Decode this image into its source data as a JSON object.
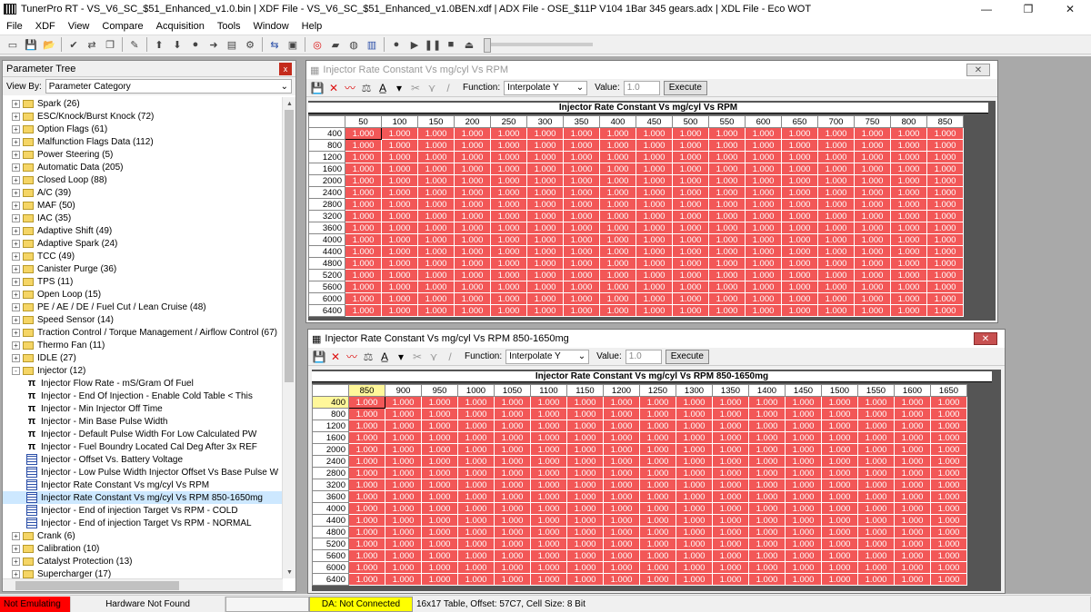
{
  "window": {
    "title": "TunerPro RT - VS_V6_SC_$51_Enhanced_v1.0.bin | XDF File - VS_V6_SC_$51_Enhanced_v1.0BEN.xdf | ADX File - OSE_$11P V104 1Bar 345 gears.adx | XDL File - Eco WOT",
    "minimize": "—",
    "maximize": "❐",
    "close": "✕"
  },
  "menu": [
    "File",
    "XDF",
    "View",
    "Compare",
    "Acquisition",
    "Tools",
    "Window",
    "Help"
  ],
  "toolbar_icons": [
    "new-icon",
    "save-icon",
    "open-icon",
    "check-icon",
    "compare-icon",
    "copy-icon",
    "script-icon",
    "up-arrow-icon",
    "down-arrow-icon",
    "record-icon",
    "forward-icon",
    "bookmark-icon",
    "link-icon",
    "swap-icon",
    "chip-icon",
    "target-icon",
    "folder-icon",
    "globe-icon",
    "chart-icon",
    "circle-icon",
    "play-icon",
    "pause-icon",
    "stop-icon",
    "eject-icon"
  ],
  "tree": {
    "title": "Parameter Tree",
    "close": "x",
    "view_by_label": "View By:",
    "view_by_value": "Parameter Category",
    "items": [
      {
        "label": "Spark (26)",
        "type": "folder",
        "exp": "+"
      },
      {
        "label": "ESC/Knock/Burst Knock (72)",
        "type": "folder",
        "exp": "+"
      },
      {
        "label": "Option Flags (61)",
        "type": "folder",
        "exp": "+"
      },
      {
        "label": "Malfunction Flags Data (112)",
        "type": "folder",
        "exp": "+"
      },
      {
        "label": "Power Steering (5)",
        "type": "folder",
        "exp": "+"
      },
      {
        "label": "Automatic Data (205)",
        "type": "folder",
        "exp": "+"
      },
      {
        "label": "Closed Loop (88)",
        "type": "folder",
        "exp": "+"
      },
      {
        "label": "A/C (39)",
        "type": "folder",
        "exp": "+"
      },
      {
        "label": "MAF (50)",
        "type": "folder",
        "exp": "+"
      },
      {
        "label": "IAC (35)",
        "type": "folder",
        "exp": "+"
      },
      {
        "label": "Adaptive Shift (49)",
        "type": "folder",
        "exp": "+"
      },
      {
        "label": "Adaptive Spark (24)",
        "type": "folder",
        "exp": "+"
      },
      {
        "label": "TCC (49)",
        "type": "folder",
        "exp": "+"
      },
      {
        "label": "Canister Purge (36)",
        "type": "folder",
        "exp": "+"
      },
      {
        "label": "TPS (11)",
        "type": "folder",
        "exp": "+"
      },
      {
        "label": "Open Loop (15)",
        "type": "folder",
        "exp": "+"
      },
      {
        "label": "PE / AE / DE / Fuel Cut / Lean Cruise (48)",
        "type": "folder",
        "exp": "+"
      },
      {
        "label": "Speed Sensor (14)",
        "type": "folder",
        "exp": "+"
      },
      {
        "label": "Traction Control / Torque Management / Airflow Control (67)",
        "type": "folder",
        "exp": "+"
      },
      {
        "label": "Thermo Fan (11)",
        "type": "folder",
        "exp": "+"
      },
      {
        "label": "IDLE (27)",
        "type": "folder",
        "exp": "+"
      },
      {
        "label": "Injector (12)",
        "type": "folder",
        "exp": "-"
      },
      {
        "label": "Injector Flow Rate - mS/Gram Of Fuel",
        "type": "pi"
      },
      {
        "label": "Injector - End Of Injection - Enable Cold Table < This",
        "type": "pi"
      },
      {
        "label": "Injector - Min Injector Off Time",
        "type": "pi"
      },
      {
        "label": "Injector - Min Base Pulse Width",
        "type": "pi"
      },
      {
        "label": "Injector - Default Pulse Width For Low Calculated PW",
        "type": "pi"
      },
      {
        "label": "Injector - Fuel Boundry Located Cal Deg After 3x REF",
        "type": "pi"
      },
      {
        "label": "Injector - Offset Vs. Battery Voltage",
        "type": "table"
      },
      {
        "label": "Injector - Low Pulse Width Injector Offset Vs Base Pulse W",
        "type": "table"
      },
      {
        "label": "Injector Rate Constant Vs mg/cyl Vs RPM",
        "type": "table"
      },
      {
        "label": "Injector Rate Constant Vs mg/cyl Vs RPM 850-1650mg",
        "type": "table",
        "selected": true
      },
      {
        "label": "Injector - End of injection Target Vs RPM - COLD",
        "type": "table"
      },
      {
        "label": "Injector - End of injection Target Vs RPM - NORMAL",
        "type": "table"
      },
      {
        "label": "Crank (6)",
        "type": "folder",
        "exp": "+"
      },
      {
        "label": "Calibration (10)",
        "type": "folder",
        "exp": "+"
      },
      {
        "label": "Catalyst Protection (13)",
        "type": "folder",
        "exp": "+"
      },
      {
        "label": "Supercharger (17)",
        "type": "folder",
        "exp": "+"
      }
    ]
  },
  "window1": {
    "caption": "Injector Rate Constant Vs mg/cyl Vs RPM",
    "close": "✕",
    "function_label": "Function:",
    "function_value": "Interpolate Y",
    "value_label": "Value:",
    "value": "1.0",
    "execute": "Execute",
    "grid_title": "Injector Rate Constant Vs mg/cyl Vs RPM",
    "columns": [
      "50",
      "100",
      "150",
      "200",
      "250",
      "300",
      "350",
      "400",
      "450",
      "500",
      "550",
      "600",
      "650",
      "700",
      "750",
      "800",
      "850"
    ],
    "rows": [
      "400",
      "800",
      "1200",
      "1600",
      "2000",
      "2400",
      "2800",
      "3200",
      "3600",
      "4000",
      "4400",
      "4800",
      "5200",
      "5600",
      "6000",
      "6400"
    ],
    "cell_value": "1.000"
  },
  "window2": {
    "caption": "Injector Rate Constant Vs mg/cyl Vs RPM 850-1650mg",
    "close": "✕",
    "function_label": "Function:",
    "function_value": "Interpolate Y",
    "value_label": "Value:",
    "value": "1.0",
    "execute": "Execute",
    "grid_title": "Injector Rate Constant Vs mg/cyl Vs RPM 850-1650mg",
    "columns": [
      "850",
      "900",
      "950",
      "1000",
      "1050",
      "1100",
      "1150",
      "1200",
      "1250",
      "1300",
      "1350",
      "1400",
      "1450",
      "1500",
      "1550",
      "1600",
      "1650"
    ],
    "rows": [
      "400",
      "800",
      "1200",
      "1600",
      "2000",
      "2400",
      "2800",
      "3200",
      "3600",
      "4000",
      "4400",
      "4800",
      "5200",
      "5600",
      "6000",
      "6400"
    ],
    "cell_value": "1.000"
  },
  "status": {
    "emulation": "Not Emulating",
    "hardware": "Hardware Not Found",
    "da": "DA: Not Connected",
    "info": "16x17 Table, Offset: 57C7,  Cell Size: 8 Bit"
  }
}
